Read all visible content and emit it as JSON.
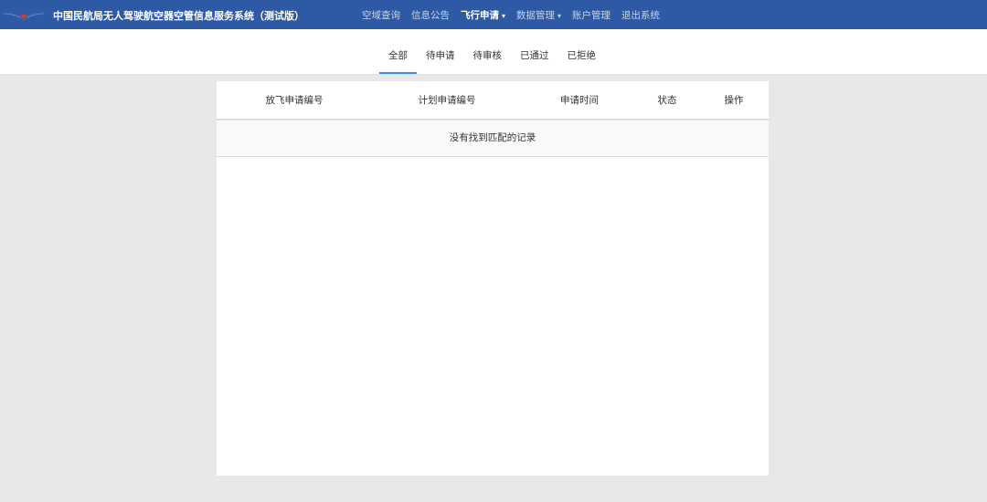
{
  "header": {
    "title": "中国民航局无人驾驶航空器空管信息服务系统（测试版）",
    "logo_icon": "caac-wings-logo-icon",
    "menu": [
      {
        "label": "空域查询",
        "active": false
      },
      {
        "label": "信息公告",
        "active": false
      },
      {
        "label": "飞行申请",
        "active": true,
        "dropdown": true
      },
      {
        "label": "数据管理",
        "active": false,
        "dropdown": true
      },
      {
        "label": "账户管理",
        "active": false
      },
      {
        "label": "退出系统",
        "active": false
      }
    ],
    "background": "#2e5aa5"
  },
  "tabs": {
    "items": [
      "全部",
      "待申请",
      "待审核",
      "已通过",
      "已拒绝"
    ],
    "active_index": 0,
    "accent": "#3a90d8"
  },
  "table": {
    "columns": [
      "放飞申请编号",
      "计划申请编号",
      "申请时间",
      "状态",
      "操作"
    ],
    "empty_text": "没有找到匹配的记录"
  }
}
